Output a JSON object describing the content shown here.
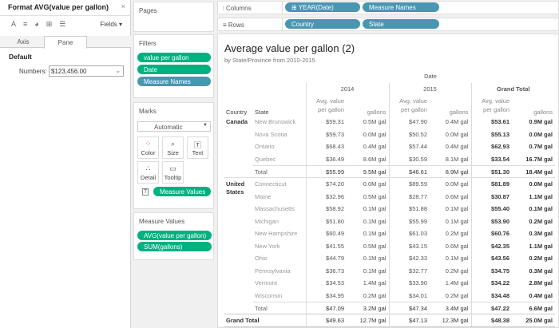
{
  "format_pane": {
    "title": "Format AVG(value per gallon)",
    "close": "×",
    "fields_label": "Fields ▾",
    "toolbar_icons": [
      "font-icon",
      "alignment-icon",
      "shading-icon",
      "borders-icon",
      "lines-icon"
    ],
    "tabs": [
      "Axis",
      "Pane"
    ],
    "active_tab": "Pane",
    "section": "Default",
    "numbers_label": "Numbers:",
    "numbers_value": "$123,456.00"
  },
  "cards": {
    "pages": "Pages",
    "filters": {
      "title": "Filters",
      "items": [
        "value per gallon",
        "Date",
        "Measure Names"
      ]
    },
    "marks": {
      "title": "Marks",
      "type": "Automatic",
      "buttons": [
        "Color",
        "Size",
        "Text",
        "Detail",
        "Tooltip"
      ],
      "pill": "Measure Values"
    },
    "measure_values": {
      "title": "Measure Values",
      "items": [
        "AVG(value per gallon)",
        "SUM(gallons)"
      ]
    }
  },
  "shelves": {
    "columns": {
      "label": "Columns",
      "pills": [
        "YEAR(Date)",
        "Measure Names"
      ]
    },
    "rows": {
      "label": "Rows",
      "pills": [
        "Country",
        "State"
      ]
    }
  },
  "colors": {
    "measure_pill": "#00b180",
    "dimension_pill": "#4996b2"
  },
  "view": {
    "title": "Average value per gallon (2)",
    "subtitle": "by State/Province from 2010-2015",
    "date_header": "Date",
    "years": [
      "2014",
      "2015",
      "Grand Total"
    ],
    "row_headers": [
      "Country",
      "State"
    ],
    "measures": [
      "Avg. value per gallon",
      "gallons"
    ],
    "groups": [
      {
        "country": "Canada",
        "rows": [
          [
            "New Brunswick",
            "$59.31",
            "0.5M gal",
            "$47.90",
            "0.4M gal",
            "$53.61",
            "0.9M gal"
          ],
          [
            "Nova Scotia",
            "$59.73",
            "0.0M gal",
            "$50.52",
            "0.0M gal",
            "$55.13",
            "0.0M gal"
          ],
          [
            "Ontario",
            "$68.43",
            "0.4M gal",
            "$57.44",
            "0.4M gal",
            "$62.93",
            "0.7M gal"
          ],
          [
            "Quebec",
            "$36.49",
            "8.6M gal",
            "$30.59",
            "8.1M gal",
            "$33.54",
            "16.7M gal"
          ],
          [
            "Total",
            "$55.99",
            "9.5M gal",
            "$46.61",
            "8.9M gal",
            "$51.30",
            "18.4M gal"
          ]
        ]
      },
      {
        "country": "United States",
        "rows": [
          [
            "Connecticut",
            "$74.20",
            "0.0M gal",
            "$89.59",
            "0.0M gal",
            "$81.89",
            "0.0M gal"
          ],
          [
            "Maine",
            "$32.96",
            "0.5M gal",
            "$28.77",
            "0.6M gal",
            "$30.87",
            "1.1M gal"
          ],
          [
            "Massachusetts",
            "$58.92",
            "0.1M gal",
            "$51.88",
            "0.1M gal",
            "$55.40",
            "0.1M gal"
          ],
          [
            "Michigan",
            "$51.80",
            "0.1M gal",
            "$55.99",
            "0.1M gal",
            "$53.90",
            "0.2M gal"
          ],
          [
            "New Hampshire",
            "$60.49",
            "0.1M gal",
            "$61.03",
            "0.2M gal",
            "$60.76",
            "0.3M gal"
          ],
          [
            "New York",
            "$41.55",
            "0.5M gal",
            "$43.15",
            "0.6M gal",
            "$42.35",
            "1.1M gal"
          ],
          [
            "Ohio",
            "$44.79",
            "0.1M gal",
            "$42.33",
            "0.1M gal",
            "$43.56",
            "0.2M gal"
          ],
          [
            "Pennsylvania",
            "$36.73",
            "0.1M gal",
            "$32.77",
            "0.2M gal",
            "$34.75",
            "0.3M gal"
          ],
          [
            "Vermont",
            "$34.53",
            "1.4M gal",
            "$33.90",
            "1.4M gal",
            "$34.22",
            "2.8M gal"
          ],
          [
            "Wisconsin",
            "$34.95",
            "0.2M gal",
            "$34.01",
            "0.2M gal",
            "$34.48",
            "0.4M gal"
          ],
          [
            "Total",
            "$47.09",
            "3.2M gal",
            "$47.34",
            "3.4M gal",
            "$47.22",
            "6.6M gal"
          ]
        ]
      }
    ],
    "grand_total": [
      "Grand Total",
      "$49.63",
      "12.7M gal",
      "$47.13",
      "12.3M gal",
      "$48.38",
      "25.0M gal"
    ]
  }
}
